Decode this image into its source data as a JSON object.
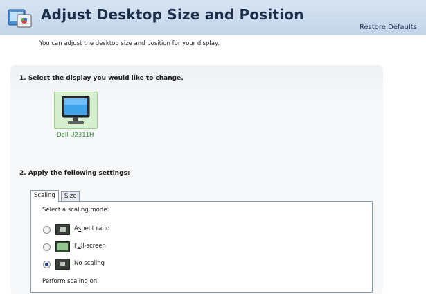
{
  "header": {
    "title": "Adjust Desktop Size and Position",
    "restore_label": "Restore Defaults"
  },
  "subtitle": "You can adjust the desktop size and position for your display.",
  "section1": {
    "heading": "1. Select the display you would like to change.",
    "display": {
      "label": "Dell U2311H",
      "icon": "monitor-icon",
      "selected": true
    }
  },
  "section2": {
    "heading": "2. Apply the following settings:",
    "tabs": [
      {
        "label": "Scaling",
        "active": true
      },
      {
        "label": "Size",
        "active": false
      }
    ],
    "scaling_mode_label": "Select a scaling mode:",
    "options": [
      {
        "prefix": "A",
        "mnemonic": "s",
        "rest": "pect ratio",
        "checked": false,
        "icon": "aspect-ratio-icon"
      },
      {
        "prefix": "F",
        "mnemonic": "u",
        "rest": "ll-screen",
        "checked": false,
        "icon": "full-screen-icon"
      },
      {
        "prefix": "",
        "mnemonic": "N",
        "rest": "o scaling",
        "checked": true,
        "icon": "no-scaling-icon"
      }
    ],
    "perform_on_label": "Perform scaling on:"
  },
  "colors": {
    "header_bg": "#c9d9ec",
    "selected_tile_bg": "#d6efcf",
    "display_label": "#2f8c2f"
  }
}
